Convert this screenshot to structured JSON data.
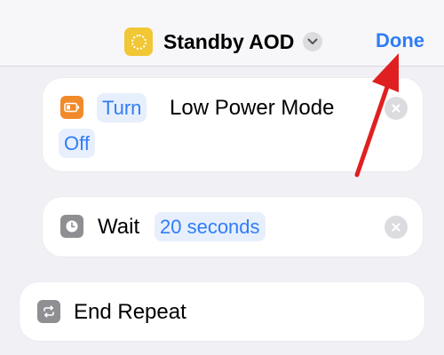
{
  "header": {
    "title": "Standby AOD",
    "done_label": "Done"
  },
  "actions": [
    {
      "icon": "battery-icon",
      "icon_color": "#f08a2a",
      "verb": "Turn",
      "object": "Low Power Mode",
      "state": "Off"
    },
    {
      "icon": "clock-icon",
      "icon_color": "#8e8e93",
      "verb": "Wait",
      "duration": "20 seconds"
    },
    {
      "icon": "repeat-icon",
      "icon_color": "#8e8e93",
      "label": "End Repeat"
    }
  ],
  "colors": {
    "accent": "#2f7df6",
    "app_icon": "#f2c736",
    "annotation_arrow": "#e02020"
  }
}
